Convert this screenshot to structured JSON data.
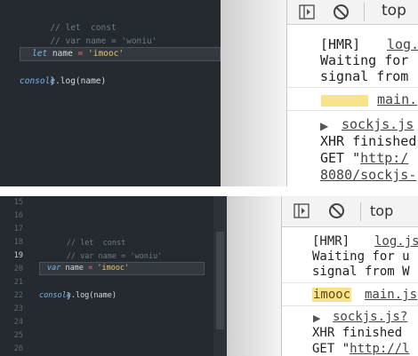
{
  "top_panel": {
    "editor": {
      "code": {
        "comment_1": "// let  const",
        "comment_2": "// var name = 'woniu'",
        "open_brace": "{",
        "keyword": "let",
        "identifier": "name",
        "operator": "=",
        "string": "'imooc'",
        "close_brace": "}",
        "call_object": "console",
        "call_rest": ".log(name)"
      }
    },
    "devtools": {
      "toolbar": {
        "context": "top"
      },
      "console": {
        "hmr_prefix": "[HMR]",
        "hmr_source": "log.",
        "hmr_line_2": "Waiting for",
        "hmr_line_3": "signal from",
        "output_source": "main.",
        "sockjs_source": "sockjs.js",
        "xhr_line": "XHR finished",
        "get_prefix": "GET \"",
        "get_url_1": "http:/",
        "get_url_2": "8080/sockjs-"
      }
    }
  },
  "bottom_panel": {
    "editor": {
      "line_numbers": [
        "15",
        "16",
        "17",
        "18",
        "19",
        "20",
        "21",
        "22",
        "23",
        "24",
        "25",
        "26"
      ],
      "active_line": "19",
      "code": {
        "comment_1": "// let  const",
        "comment_2": "// var name = 'woniu'",
        "open_brace": "{",
        "keyword": "var",
        "identifier": "name",
        "operator": "=",
        "string": "'imooc'",
        "close_brace": "}",
        "call_object": "console",
        "call_rest": ".log(name)"
      }
    },
    "devtools": {
      "toolbar": {
        "context": "top"
      },
      "console": {
        "hmr_prefix": "[HMR]",
        "hmr_source": "log.js",
        "hmr_line_2": "Waiting for u",
        "hmr_line_3": "signal from W",
        "output_value": "imooc",
        "output_source": "main.js",
        "sockjs_source": "sockjs.js?",
        "xhr_line": "XHR finished",
        "get_prefix": "GET \"",
        "get_url": "http://l"
      }
    }
  },
  "colors": {
    "editor_bg": "#242a30",
    "keyword": "#79b5ec",
    "string": "#e8c56b",
    "operator": "#e06c75",
    "comment": "#6e7882",
    "highlight_badge": "#f8e38a"
  },
  "icons": [
    "sidebar-toggle-icon",
    "clear-console-icon",
    "expand-triangle-icon"
  ]
}
